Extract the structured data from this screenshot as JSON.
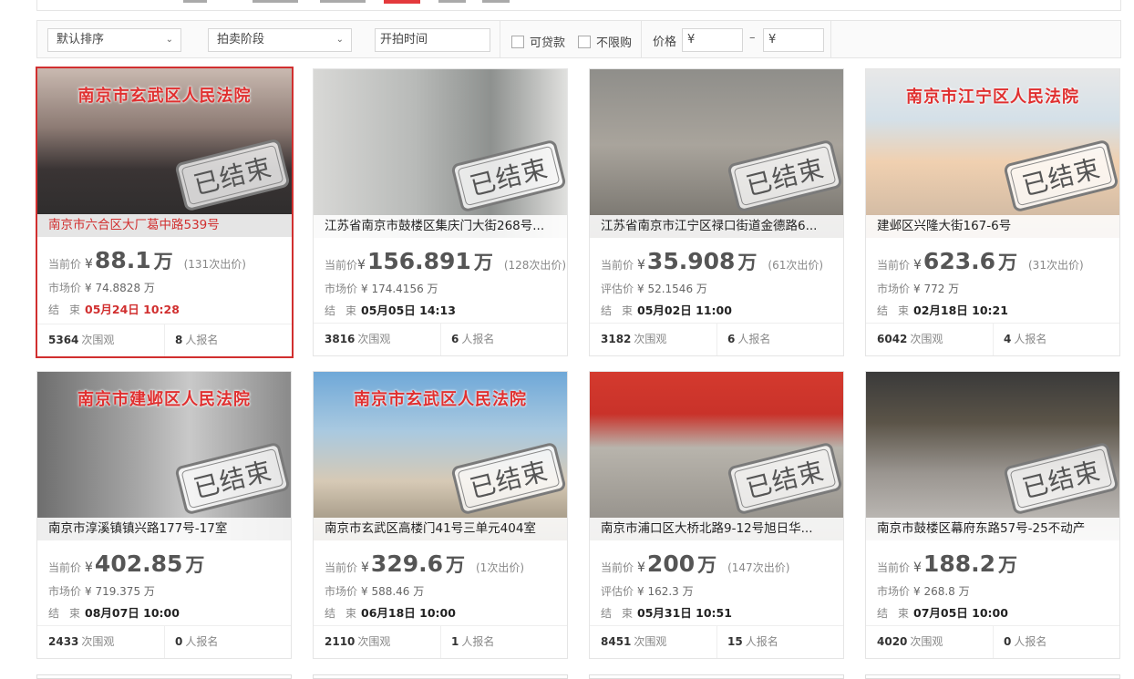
{
  "filters": {
    "sort": "默认排序",
    "stage": "拍卖阶段",
    "start_time": "开拍时间",
    "loan": "可贷款",
    "no_limit": "不限购",
    "price_label": "价格",
    "price_min": "¥",
    "price_max": "¥",
    "dash": "–"
  },
  "labels": {
    "current": "当前价",
    "market": "市场价",
    "appraisal": "评估价",
    "end": "结束",
    "yen": "¥",
    "wan": "万",
    "views_suffix": "次围观",
    "signups_suffix": "人报名",
    "ended_stamp": "已结束"
  },
  "cards": [
    {
      "title": "南京市六合区大厂葛中路539号",
      "price": "88.1",
      "bids": "(131次出价)",
      "ref_label": "市场价",
      "ref_value": "¥ 74.8828 万",
      "end": "05月24日 10:28",
      "views": "5364",
      "signups": "8",
      "court": "南京市玄武区人民法院",
      "active": true
    },
    {
      "title": "江苏省南京市鼓楼区集庆门大街268号...",
      "price": "156.891",
      "bids": "(128次出价)",
      "ref_label": "市场价",
      "ref_value": "¥ 174.4156 万",
      "end": "05月05日 14:13",
      "views": "3816",
      "signups": "6",
      "court": ""
    },
    {
      "title": "江苏省南京市江宁区禄口街道金德路6...",
      "price": "35.908",
      "bids": "(61次出价)",
      "ref_label": "评估价",
      "ref_value": "¥ 52.1546 万",
      "end": "05月02日 11:00",
      "views": "3182",
      "signups": "6",
      "court": ""
    },
    {
      "title": "建邺区兴隆大街167-6号",
      "price": "623.6",
      "bids": "(31次出价)",
      "ref_label": "市场价",
      "ref_value": "¥ 772 万",
      "end": "02月18日 10:21",
      "views": "6042",
      "signups": "4",
      "court": "南京市江宁区人民法院"
    },
    {
      "title": "南京市淳溪镇镇兴路177号-17室",
      "price": "402.85",
      "bids": "",
      "ref_label": "市场价",
      "ref_value": "¥ 719.375 万",
      "end": "08月07日 10:00",
      "views": "2433",
      "signups": "0",
      "court": "南京市建邺区人民法院"
    },
    {
      "title": "南京市玄武区高楼门41号三单元404室",
      "price": "329.6",
      "bids": "(1次出价)",
      "ref_label": "市场价",
      "ref_value": "¥ 588.46 万",
      "end": "06月18日 10:00",
      "views": "2110",
      "signups": "1",
      "court": "南京市玄武区人民法院"
    },
    {
      "title": "南京市浦口区大桥北路9-12号旭日华...",
      "price": "200",
      "bids": "(147次出价)",
      "ref_label": "评估价",
      "ref_value": "¥ 162.3 万",
      "end": "05月31日 10:51",
      "views": "8451",
      "signups": "15",
      "court": ""
    },
    {
      "title": "南京市鼓楼区幕府东路57号-25不动产",
      "price": "188.2",
      "bids": "",
      "ref_label": "市场价",
      "ref_value": "¥ 268.8 万",
      "end": "07月05日 10:00",
      "views": "4020",
      "signups": "0",
      "court": ""
    }
  ],
  "colors": {
    "accent": "#e4393c",
    "active_border": "#d12f2f"
  }
}
